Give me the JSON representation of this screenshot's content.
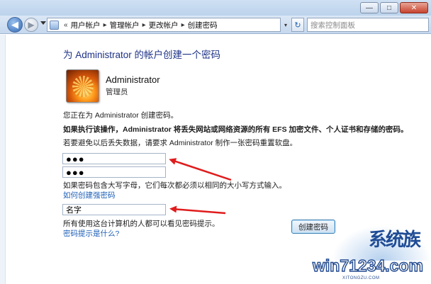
{
  "window": {
    "minimize_glyph": "—",
    "maximize_glyph": "□",
    "close_glyph": "✕"
  },
  "navbar": {
    "back_glyph": "◀",
    "forward_glyph": "▶",
    "breadcrumb_lead": "«",
    "breadcrumbs": [
      "用户帐户",
      "管理帐户",
      "更改帐户",
      "创建密码"
    ],
    "separator": "▸",
    "address_dropdown_glyph": "▾",
    "refresh_glyph": "↻",
    "search_placeholder": "搜索控制面板"
  },
  "main": {
    "title": "为 Administrator 的帐户创建一个密码",
    "user": {
      "name": "Administrator",
      "role": "管理员"
    },
    "intro_text": "您正在为 Administrator 创建密码。",
    "warning_text": "如果执行该操作，Administrator 将丢失网站或网络资源的所有 EFS 加密文件、个人证书和存储的密码。",
    "reset_disk_text": "若要避免以后丢失数据，请要求 Administrator 制作一张密码重置软盘。",
    "new_password_value": "●●●",
    "confirm_password_value": "●●●",
    "case_note": "如果密码包含大写字母，它们每次都必须以相同的大小写方式输入。",
    "strong_password_link": "如何创建强密码",
    "hint_value": "名字",
    "hint_note": "所有使用这台计算机的人都可以看见密码提示。",
    "hint_link": "密码提示是什么?",
    "create_button": "创建密码"
  },
  "watermark": {
    "text": "win71234.com",
    "sub": "XITONGZU.COM",
    "chars": "系统族"
  },
  "colors": {
    "title": "#1e3287",
    "link": "#1d5fb8",
    "arrow": "#e01c1c"
  }
}
